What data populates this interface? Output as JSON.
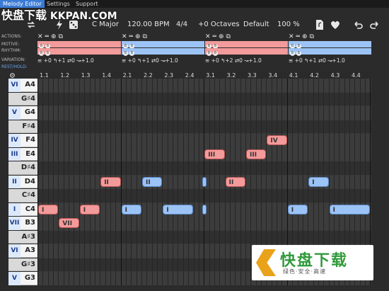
{
  "menu": {
    "tabs": [
      "Melody Editor",
      "Settings",
      "Support"
    ]
  },
  "watermark_top": {
    "text": "快盘下载",
    "domain": "KKPAN.COM"
  },
  "toolbar": {
    "key": "C Major",
    "tempo": "120.00 BPM",
    "time_signature": "4/4",
    "octaves": "+0 Octaves",
    "preset": "Default",
    "zoom": "100 %"
  },
  "lanes": {
    "actions": "ACTIONS:",
    "motive": "MOTIVE:",
    "rhythm": "RHYTHM:",
    "variation": "VARIATION:",
    "rest_hold": "REST/HOLD:"
  },
  "segments": [
    {
      "variation": "≡ +0 ↰+1 ⇄0 ↝+1.0"
    },
    {
      "variation": "≡ +0 ↰+1 ⇄0 ↝+1.0"
    },
    {
      "variation": "≡ +0 ↰+2 ⇄0 ↝+1.0"
    },
    {
      "variation": "≡ +0 ↰+1 ⇄0 ↝+1.0"
    }
  ],
  "ruler": [
    "1.1",
    "1.2",
    "1.3",
    "1.4",
    "2.1",
    "2.2",
    "2.3",
    "2.4",
    "3.1",
    "3.2",
    "3.3",
    "3.4",
    "4.1",
    "4.2",
    "4.3",
    "4.4"
  ],
  "keys": [
    {
      "degree": "VI",
      "note": "A4"
    },
    {
      "degree": "",
      "note": "G♯4"
    },
    {
      "degree": "V",
      "note": "G4"
    },
    {
      "degree": "",
      "note": "F♯4"
    },
    {
      "degree": "IV",
      "note": "F4"
    },
    {
      "degree": "III",
      "note": "E4"
    },
    {
      "degree": "",
      "note": "D♯4"
    },
    {
      "degree": "II",
      "note": "D4"
    },
    {
      "degree": "",
      "note": "C♯4"
    },
    {
      "degree": "I",
      "note": "C4"
    },
    {
      "degree": "VII",
      "note": "B3"
    },
    {
      "degree": "",
      "note": "A♯3"
    },
    {
      "degree": "VI",
      "note": "A3"
    },
    {
      "degree": "",
      "note": "G♯3"
    },
    {
      "degree": "V",
      "note": "G3"
    }
  ],
  "notes": [
    {
      "label": "IV",
      "color": "red"
    },
    {
      "label": "III",
      "color": "red"
    },
    {
      "label": "III",
      "color": "red"
    },
    {
      "label": "II",
      "color": "red"
    },
    {
      "label": "II",
      "color": "blue"
    },
    {
      "label": "",
      "color": "blue"
    },
    {
      "label": "II",
      "color": "red"
    },
    {
      "label": "I",
      "color": "blue"
    },
    {
      "label": "I",
      "color": "red"
    },
    {
      "label": "I",
      "color": "red"
    },
    {
      "label": "I",
      "color": "blue"
    },
    {
      "label": "I",
      "color": "blue"
    },
    {
      "label": "",
      "color": "blue"
    },
    {
      "label": "I",
      "color": "blue"
    },
    {
      "label": "I",
      "color": "blue"
    },
    {
      "label": "VII",
      "color": "red"
    }
  ],
  "watermark_bottom": {
    "title": "快盘下载",
    "subtitle": "绿色·安全·高速"
  },
  "colors": {
    "accent": "#3a7bd5",
    "note_red": "#f39a9a",
    "note_blue": "#9cc3f5"
  }
}
